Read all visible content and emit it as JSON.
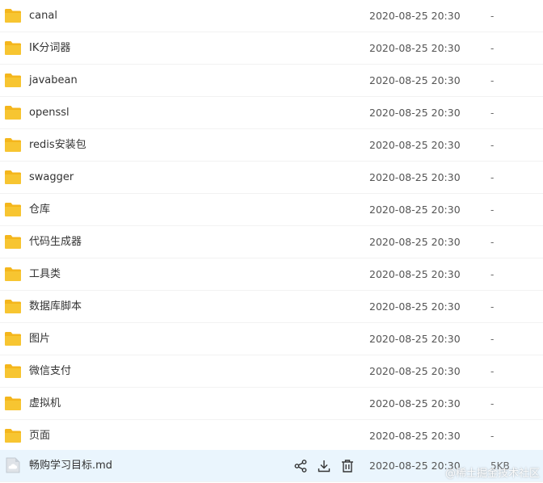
{
  "files": [
    {
      "name": "canal",
      "date": "2020-08-25 20:30",
      "size": "-",
      "type": "folder"
    },
    {
      "name": "IK分词器",
      "date": "2020-08-25 20:30",
      "size": "-",
      "type": "folder"
    },
    {
      "name": "javabean",
      "date": "2020-08-25 20:30",
      "size": "-",
      "type": "folder"
    },
    {
      "name": "openssl",
      "date": "2020-08-25 20:30",
      "size": "-",
      "type": "folder"
    },
    {
      "name": "redis安装包",
      "date": "2020-08-25 20:30",
      "size": "-",
      "type": "folder"
    },
    {
      "name": "swagger",
      "date": "2020-08-25 20:30",
      "size": "-",
      "type": "folder"
    },
    {
      "name": "仓库",
      "date": "2020-08-25 20:30",
      "size": "-",
      "type": "folder"
    },
    {
      "name": "代码生成器",
      "date": "2020-08-25 20:30",
      "size": "-",
      "type": "folder"
    },
    {
      "name": "工具类",
      "date": "2020-08-25 20:30",
      "size": "-",
      "type": "folder"
    },
    {
      "name": "数据库脚本",
      "date": "2020-08-25 20:30",
      "size": "-",
      "type": "folder"
    },
    {
      "name": "图片",
      "date": "2020-08-25 20:30",
      "size": "-",
      "type": "folder"
    },
    {
      "name": "微信支付",
      "date": "2020-08-25 20:30",
      "size": "-",
      "type": "folder"
    },
    {
      "name": "虚拟机",
      "date": "2020-08-25 20:30",
      "size": "-",
      "type": "folder"
    },
    {
      "name": "页面",
      "date": "2020-08-25 20:30",
      "size": "-",
      "type": "folder"
    },
    {
      "name": "畅购学习目标.md",
      "date": "2020-08-25 20:30",
      "size": "5KB",
      "type": "file",
      "highlighted": true
    }
  ],
  "row_actions": [
    "share-icon",
    "download-icon",
    "delete-icon"
  ],
  "watermark": "@稀土掘金技术社区",
  "colors": {
    "folder": "#f7c531",
    "folder_tab": "#f4b61c",
    "highlight_row": "#eaf5fd",
    "action_icon": "#333333"
  }
}
